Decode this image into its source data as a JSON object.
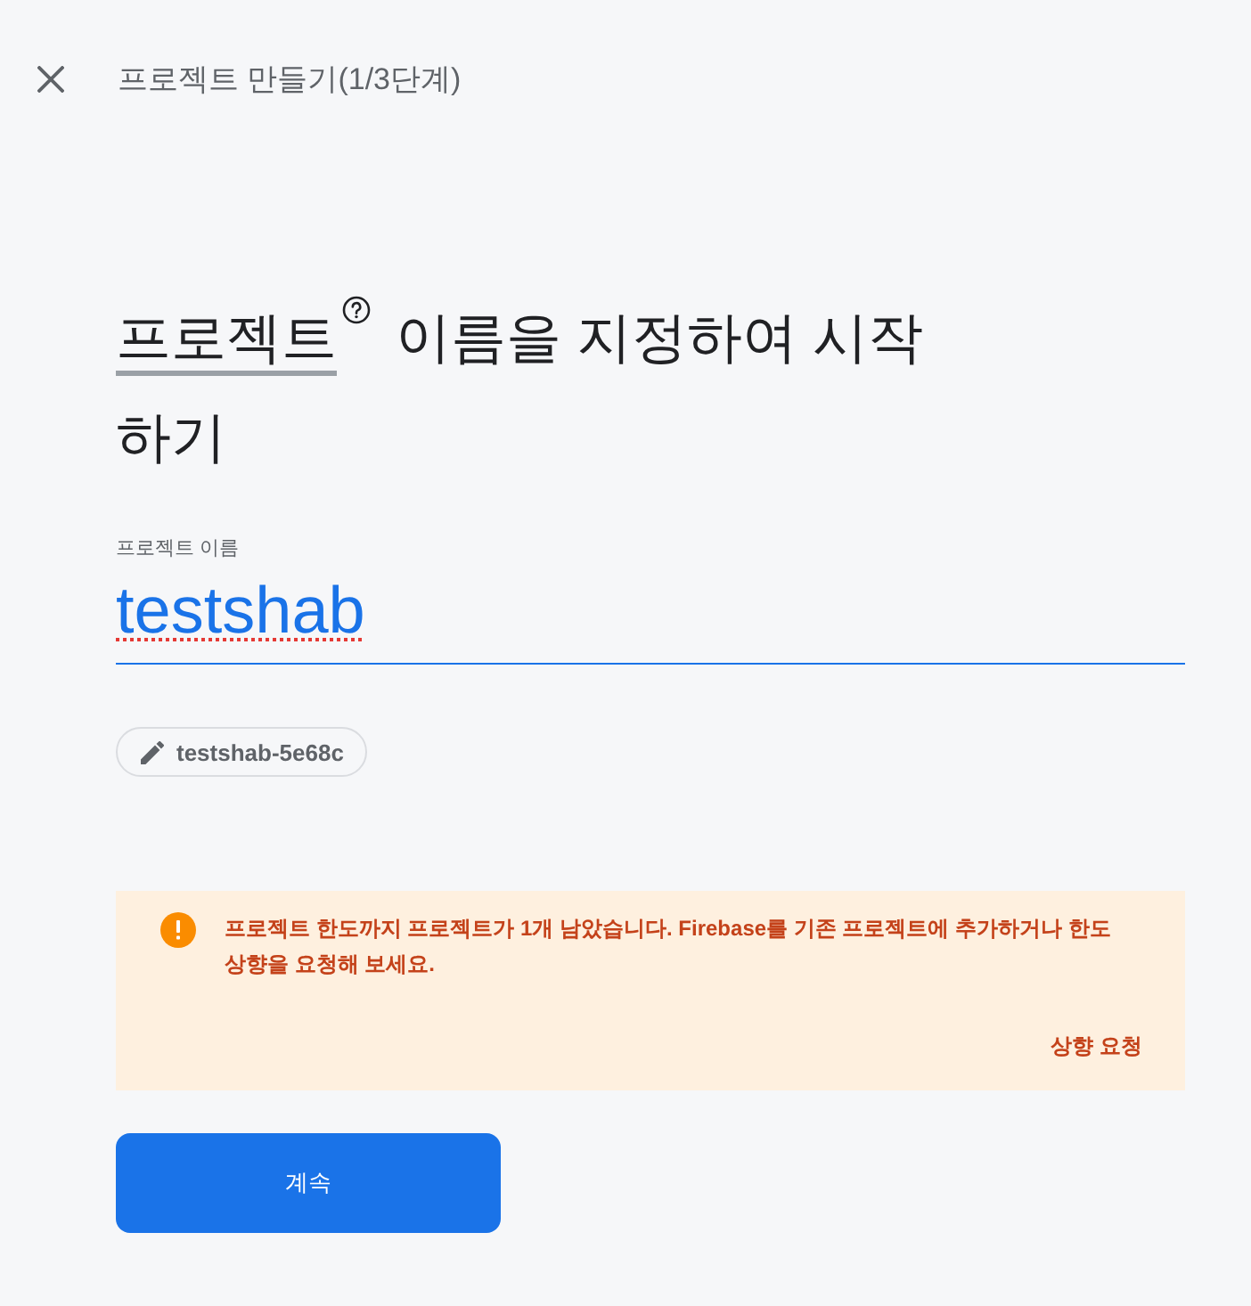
{
  "header": {
    "title": "프로젝트 만들기(1/3단계)"
  },
  "heading": {
    "term": "프로젝트",
    "text": "이름을 지정하여 시작하기"
  },
  "project_name_field": {
    "label": "프로젝트 이름",
    "value": "testshab",
    "focused": true,
    "spellcheck_error": true
  },
  "project_id_chip": {
    "text": "testshab-5e68c"
  },
  "warning": {
    "message": "프로젝트 한도까지 프로젝트가 1개 남았습니다. Firebase를 기존 프로젝트에 추가하거나 한도 상향을 요청해 보세요.",
    "action": "상향 요청"
  },
  "continue_button": {
    "label": "계속"
  }
}
